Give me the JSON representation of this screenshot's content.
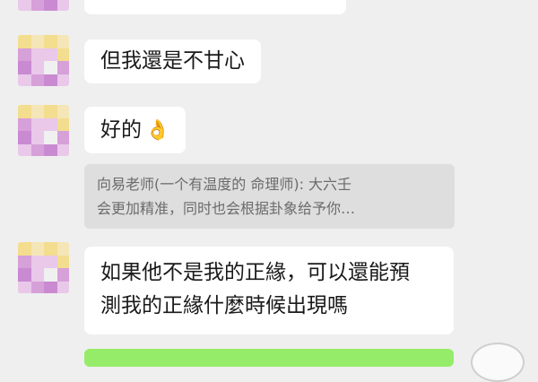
{
  "messages": [
    {
      "id": "msg-partial",
      "text": ""
    },
    {
      "id": "msg-1",
      "text": "但我還是不甘心"
    },
    {
      "id": "msg-2",
      "text": "好的",
      "emoji": "👌"
    },
    {
      "id": "quote",
      "lines": [
        "向易老师(一个有温度的 命理师): 大六壬",
        "会更加精准，同时也会根据卦象给予你…"
      ]
    },
    {
      "id": "msg-3",
      "lines": [
        "如果他不是我的正緣，可以還能預",
        "測我的正緣什麼時候出現嗎"
      ]
    }
  ],
  "colors": {
    "background": "#efefef",
    "bubble_incoming": "#ffffff",
    "bubble_outgoing": "#95ec69",
    "quote_bg": "#dedede",
    "quote_text": "#6b6b6b",
    "avatar_palette": [
      "#f3dd8e",
      "#f5e6b8",
      "#e9c8ea",
      "#d6a0d9",
      "#f0f0f0",
      "#c98ad2"
    ]
  }
}
